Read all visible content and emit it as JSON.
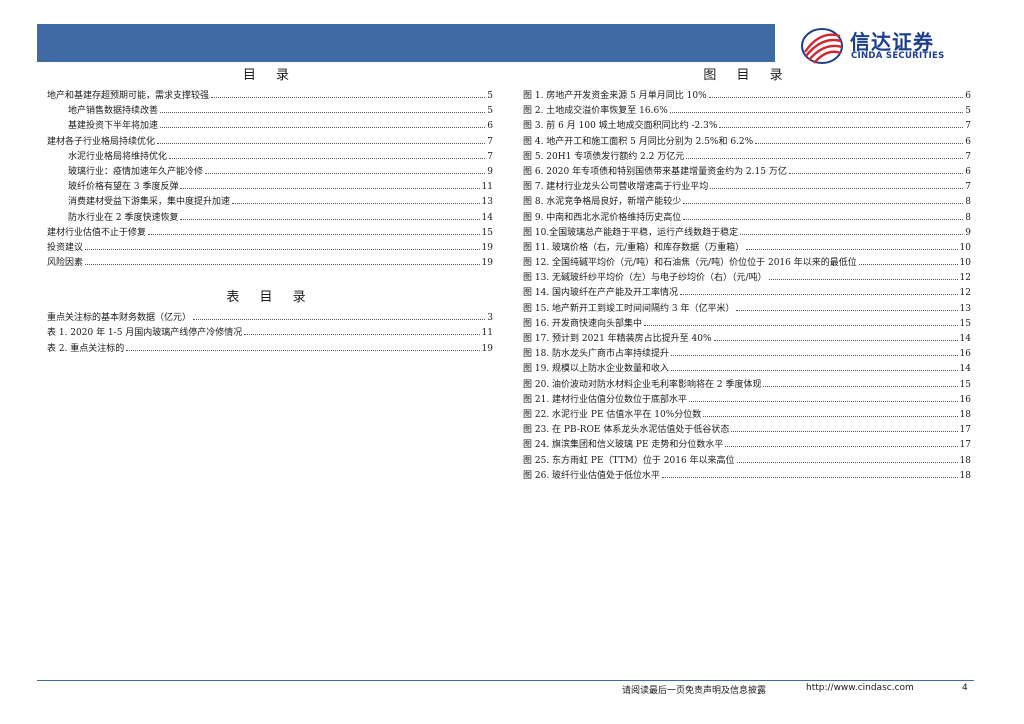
{
  "brand": {
    "name_cn": "信达证券",
    "name_en": "CINDA SECURITIES",
    "color": "#1c3f8c",
    "accent_red": "#d0282e",
    "header_color": "#3f6aa4"
  },
  "toc": {
    "title": "目 录",
    "items": [
      {
        "text": "地产和基建存超预期可能，需求支撑较强",
        "page": "5",
        "level": 1
      },
      {
        "text": "地产销售数据持续改善",
        "page": "5",
        "level": 2
      },
      {
        "text": "基建投资下半年将加速",
        "page": "6",
        "level": 2
      },
      {
        "text": "建材各子行业格局持续优化",
        "page": "7",
        "level": 1
      },
      {
        "text": "水泥行业格局将维持优化",
        "page": "7",
        "level": 2
      },
      {
        "text": "玻璃行业：疫情加速年久产能冷修",
        "page": "9",
        "level": 2
      },
      {
        "text": "玻纤价格有望在 3 季度反弹",
        "page": "11",
        "level": 2
      },
      {
        "text": "消费建材受益下游集采，集中度提升加速",
        "page": "13",
        "level": 2
      },
      {
        "text": "防水行业在 2 季度快速恢复",
        "page": "14",
        "level": 2
      },
      {
        "text": "建材行业估值不止于修复",
        "page": "15",
        "level": 1
      },
      {
        "text": "投资建议",
        "page": "19",
        "level": 1
      },
      {
        "text": "风险因素",
        "page": "19",
        "level": 1
      }
    ]
  },
  "table_toc": {
    "title": "表 目 录",
    "items": [
      {
        "text": "重点关注标的基本财务数据（亿元）",
        "page": "3"
      },
      {
        "text": "表 1. 2020 年 1-5 月国内玻璃产线停产冷修情况",
        "page": "11"
      },
      {
        "text": "表 2. 重点关注标的",
        "page": "19"
      }
    ]
  },
  "figure_toc": {
    "title": "图 目 录",
    "items": [
      {
        "text": "图 1. 房地产开发资金来源 5 月单月同比 10%",
        "page": "6"
      },
      {
        "text": "图 2. 土地成交溢价率恢复至 16.6%",
        "page": "5"
      },
      {
        "text": "图 3. 前 6 月 100 城土地成交面积同比约 -2.3%",
        "page": "7"
      },
      {
        "text": "图 4. 地产开工和施工面积 5 月同比分别为 2.5%和 6.2%",
        "page": "6"
      },
      {
        "text": "图 5. 20H1 专项债发行额约 2.2 万亿元",
        "page": "7"
      },
      {
        "text": "图 6. 2020 年专项债和特别国债带来基建增量资金约为 2.15 万亿",
        "page": "6"
      },
      {
        "text": "图 7. 建材行业龙头公司营收增速高于行业平均",
        "page": "7"
      },
      {
        "text": "图 8. 水泥竞争格局良好，新增产能较少",
        "page": "8"
      },
      {
        "text": "图 9. 中南和西北水泥价格维持历史高位",
        "page": "8"
      },
      {
        "text": "图 10.全国玻璃总产能趋于平稳，运行产线数趋于稳定",
        "page": "9"
      },
      {
        "text": "图 11. 玻璃价格（右，元/重箱）和库存数据（万重箱）",
        "page": "10"
      },
      {
        "text": "图 12. 全国纯碱平均价（元/吨）和石油焦（元/吨）价位位于 2016 年以来的最低位",
        "page": "10"
      },
      {
        "text": "图 13. 无碱玻纤纱平均价（左）与电子纱均价（右）（元/吨）",
        "page": "12"
      },
      {
        "text": "图 14. 国内玻纤在产产能及开工率情况",
        "page": "12"
      },
      {
        "text": "图 15. 地产新开工到竣工时间间隔约 3 年（亿平米）",
        "page": "13"
      },
      {
        "text": "图 16. 开发商快速向头部集中",
        "page": "15"
      },
      {
        "text": "图 17. 预计到 2021 年精装房占比提升至 40%",
        "page": "14"
      },
      {
        "text": "图 18. 防水龙头广商市占率持续提升",
        "page": "16"
      },
      {
        "text": "图 19. 规模以上防水企业数量和收入",
        "page": "14"
      },
      {
        "text": "图 20. 油价波动对防水材料企业毛利率影响将在 2 季度体现",
        "page": "15"
      },
      {
        "text": "图 21. 建材行业估值分位数位于底部水平",
        "page": "16"
      },
      {
        "text": "图 22. 水泥行业 PE 估值水平在 10%分位数",
        "page": "18"
      },
      {
        "text": "图 23. 在 PB-ROE 体系龙头水泥估值处于低谷状态",
        "page": "17"
      },
      {
        "text": "图 24. 旗滨集团和信义玻璃 PE 走势和分位数水平",
        "page": "17"
      },
      {
        "text": "图 25. 东方雨虹 PE（TTM）位于 2016 年以来高位",
        "page": "18"
      },
      {
        "text": "图 26. 玻纤行业估值处于低位水平",
        "page": "18"
      }
    ]
  },
  "footer": {
    "disclaimer": "请阅读最后一页免责声明及信息披露",
    "url": "http://www.cindasc.com",
    "page_number": "4"
  }
}
